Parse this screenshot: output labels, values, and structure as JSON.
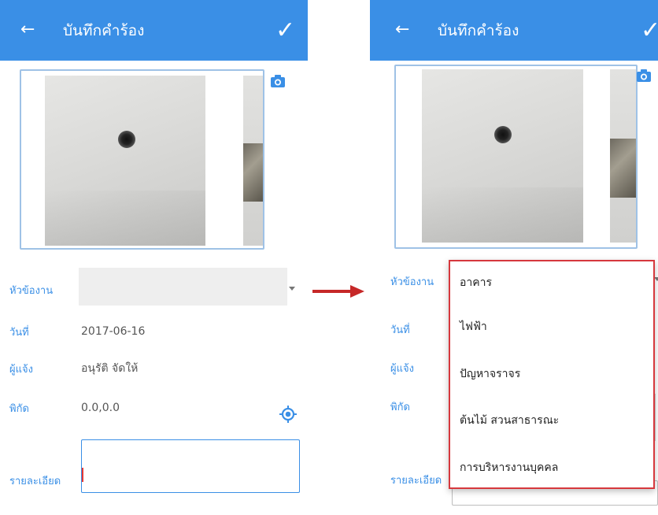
{
  "colors": {
    "primary": "#3a8fe6",
    "highlight_border": "#d6383d",
    "arrow": "#c62828",
    "field_bg": "#eeeeee"
  },
  "left_screen": {
    "appbar": {
      "back_icon": "arrow-left-icon",
      "title": "บันทึกคำร้อง",
      "confirm_icon": "check-icon"
    },
    "photos": {
      "camera_icon": "camera-icon"
    },
    "form": {
      "topic_label": "หัวข้องาน",
      "topic_value": "",
      "date_label": "วันที่",
      "date_value": "2017-06-16",
      "reporter_label": "ผู้แจ้ง",
      "reporter_value": "อนุรัติ จัดให้",
      "coords_label": "พิกัด",
      "coords_value": "0.0,0.0",
      "location_icon": "gps-target-icon",
      "details_label": "รายละเอียด",
      "details_value": ""
    }
  },
  "transition_arrow": "right-arrow-icon",
  "right_screen": {
    "appbar": {
      "back_icon": "arrow-left-icon",
      "title": "บันทึกคำร้อง",
      "confirm_icon": "check-icon"
    },
    "form": {
      "topic_label": "หัวข้องาน",
      "date_label": "วันที่",
      "reporter_label": "ผู้แจ้ง",
      "coords_label": "พิกัด",
      "details_label": "รายละเอียด"
    },
    "dropdown_options": [
      "อาคาร",
      "ไฟฟ้า",
      "ปัญหาจราจร",
      "ต้นไม้ สวนสาธารณะ",
      "การบริหารงานบุคคล"
    ]
  }
}
